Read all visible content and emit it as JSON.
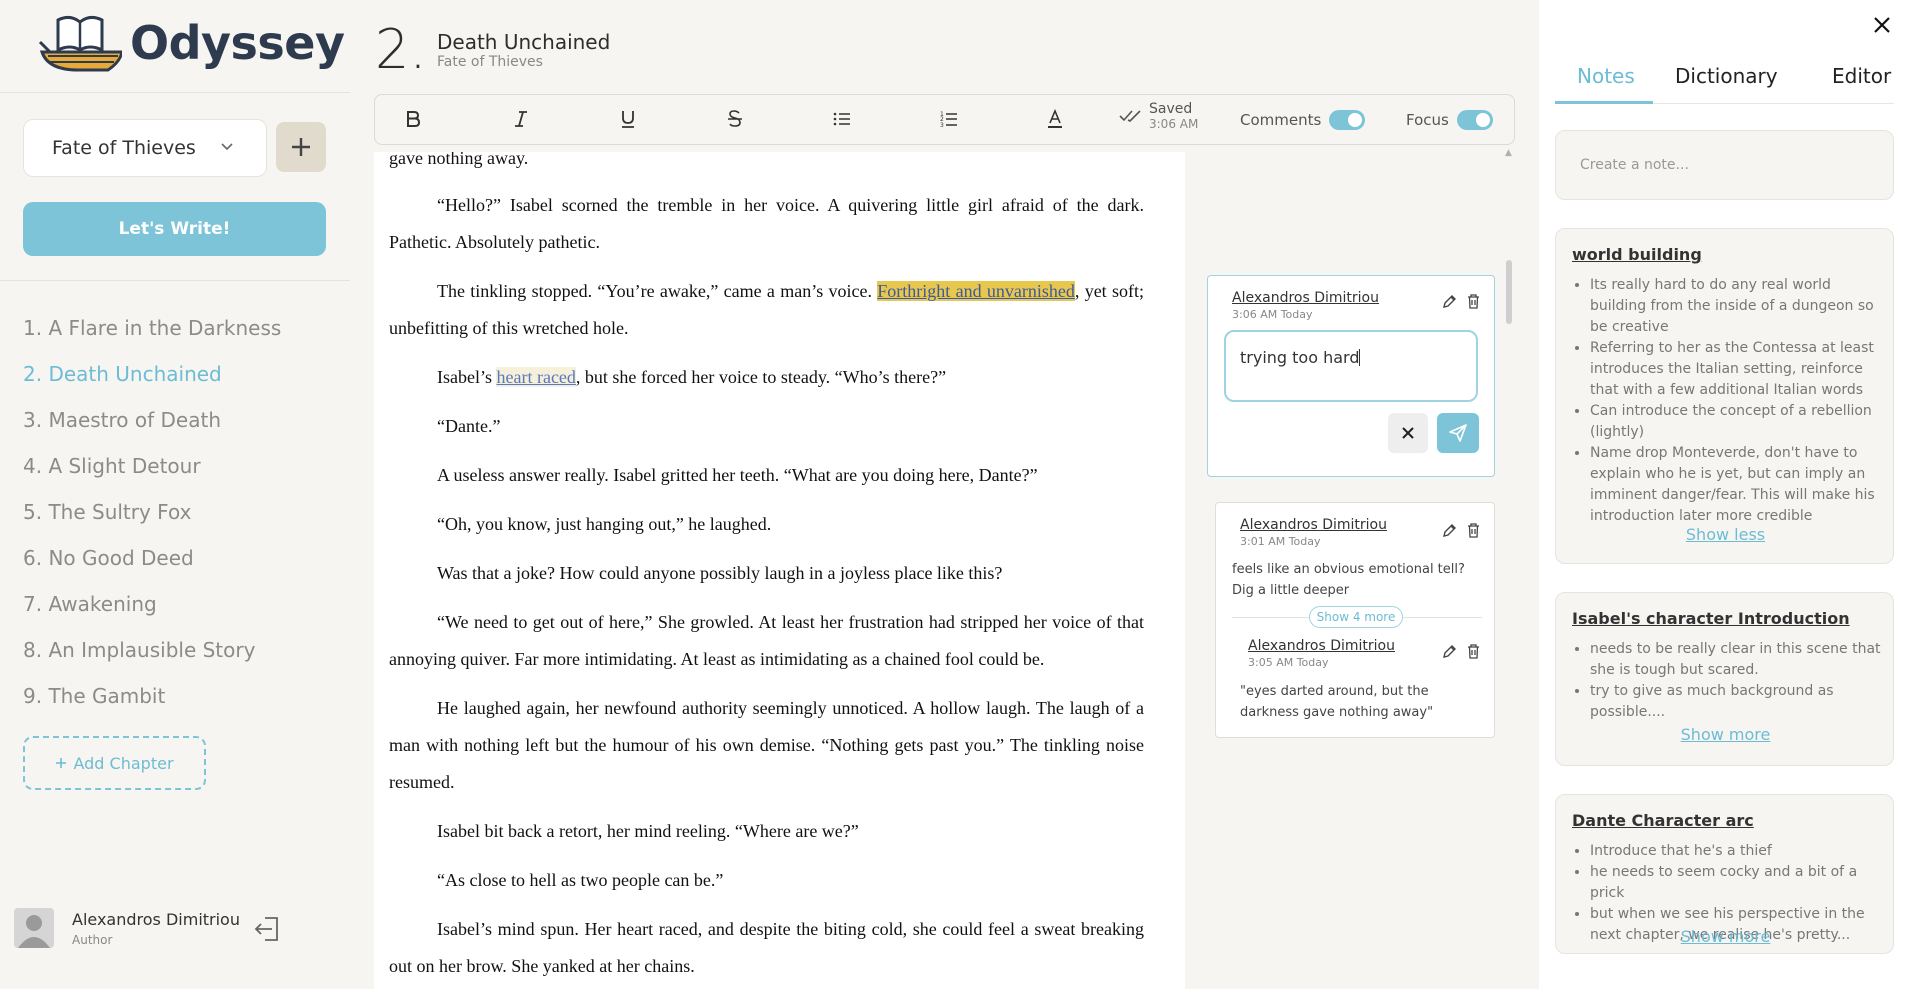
{
  "app": {
    "name": "Odyssey"
  },
  "sidebar": {
    "book_select": "Fate of Thieves",
    "write_button": "Let's Write!",
    "chapters": [
      "1. A Flare in the Darkness",
      "2. Death Unchained",
      "3. Maestro of Death",
      "4. A Slight Detour",
      "5. The Sultry Fox",
      "6. No Good Deed",
      "7. Awakening",
      "8. An Implausible Story",
      "9. The Gambit"
    ],
    "active_chapter": 1,
    "add_chapter": "Add Chapter",
    "user": {
      "name": "Alexandros Dimitriou",
      "role": "Author"
    }
  },
  "header": {
    "chapter_number": "2.",
    "chapter_title": "Death Unchained",
    "book_title": "Fate of Thieves"
  },
  "toolbar": {
    "saved_label": "Saved",
    "saved_time": "3:06 AM",
    "comments_label": "Comments",
    "comments_on": true,
    "focus_label": "Focus",
    "focus_on": true
  },
  "editor": {
    "p0": "gave nothing away.",
    "p1": "“Hello?” Isabel scorned the tremble in her voice. A quivering little girl afraid of the dark. Pathetic. Absolutely pathetic.",
    "p2_a": "The tinkling stopped. “You’re awake,” came a man’s voice. ",
    "p2_hl": "Forthright and unvarnished",
    "p2_b": ", yet soft; unbefitting of this wretched hole.",
    "p3_a": "Isabel’s ",
    "p3_hl": "heart raced",
    "p3_b": ", but she forced her voice to steady. “Who’s there?”",
    "p4": "“Dante.”",
    "p5": "A useless answer really. Isabel gritted her teeth. “What are you doing here, Dante?”",
    "p6": "“Oh, you know, just hanging out,” he laughed.",
    "p7": "Was that a joke? How could anyone possibly laugh in a joyless place like this?",
    "p8": "“We need to get out of here,” She growled. At least her frustration had stripped her voice of that annoying quiver. Far more intimidating. At least as intimidating as a chained fool could be.",
    "p9": "He laughed again, her newfound authority seemingly unnoticed. A hollow laugh. The laugh of a man with nothing left but the humour of his own demise. “Nothing gets past you.” The tinkling noise resumed.",
    "p10": "Isabel bit back a retort, her mind reeling. “Where are we?”",
    "p11": "“As close to hell as two people can be.”",
    "p12": "Isabel’s mind spun. Her heart raced, and despite the biting cold, she could feel a sweat breaking out on her brow. She yanked at her chains."
  },
  "comments": {
    "active": {
      "author": "Alexandros Dimitriou",
      "time": "3:06 AM Today",
      "input_value": "trying too hard"
    },
    "thread": {
      "first": {
        "author": "Alexandros Dimitriou",
        "time": "3:01 AM Today",
        "text": "feels like an obvious emotional tell? Dig a little deeper"
      },
      "show_more": "Show 4 more",
      "last": {
        "author": "Alexandros Dimitriou",
        "time": "3:05 AM Today",
        "text": "\"eyes darted around, but the darkness gave nothing away\""
      }
    }
  },
  "right_panel": {
    "tabs": [
      "Notes",
      "Dictionary",
      "Editor"
    ],
    "active_tab": "Notes",
    "create_placeholder": "Create a note...",
    "notes": [
      {
        "title": "world building",
        "items": [
          "Its really hard to do any real world building from the inside of a dungeon so be creative",
          "Referring to her as the Contessa at least introduces the Italian setting, reinforce that with a  few additional Italian words",
          "Can introduce the concept of a rebellion (lightly)",
          "Name drop Monteverde, don't have to explain who he is yet, but can imply an imminent danger/fear. This will make his introduction later more credible"
        ],
        "toggle": "Show less"
      },
      {
        "title": "Isabel's character Introduction",
        "items": [
          "needs to be really clear in this scene that she is tough but scared.",
          "try to give as much background as possible...."
        ],
        "toggle": "Show more"
      },
      {
        "title": "Dante Character arc",
        "items": [
          "Introduce that he's a thief",
          "he needs to seem cocky and a bit of a prick",
          "but when we see his perspective in the next chapter, we realise he's pretty..."
        ],
        "toggle": "Show more"
      }
    ]
  },
  "colors": {
    "accent": "#7ec4d8",
    "highlight": "#e7c74e",
    "logo": "#2e3a4e"
  }
}
